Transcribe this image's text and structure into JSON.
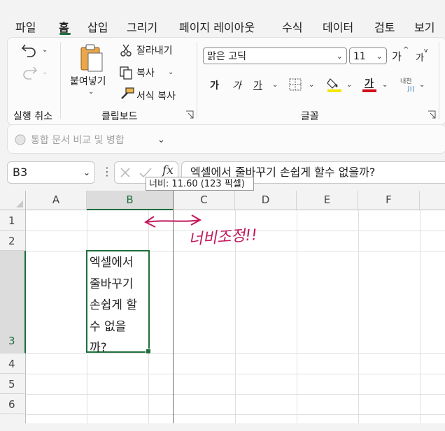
{
  "tabs": [
    "파일",
    "홈",
    "삽입",
    "그리기",
    "페이지 레이아웃",
    "수식",
    "데이터",
    "검토",
    "보기"
  ],
  "ribbon": {
    "paste_label": "붙여넣기",
    "cut_label": "잘라내기",
    "copy_label": "복사",
    "format_painter_label": "서식 복사",
    "undo_group_label": "실행 취소",
    "clipboard_group_label": "클립보드",
    "font_group_label": "글꼴",
    "font_name": "맑은 고딕",
    "font_size": "11",
    "grow_font_label": "가",
    "shrink_font_label": "가",
    "bold_label": "가",
    "italic_label": "가",
    "underline_label": "가",
    "font_color_label": "가",
    "phonetic_label": "내천",
    "highlight_color": "#f5e600",
    "font_color": "#d0101c"
  },
  "collab": {
    "compare_merge_label": "통합 문서 비교 및 병합"
  },
  "formula_bar": {
    "name_box": "B3",
    "fx_label": "fx",
    "content": "엑셀에서 줄바꾸기 손쉽게 할수 없을까?"
  },
  "tooltip": "너비: 11.60 (123 픽셀)",
  "columns": [
    "A",
    "B",
    "C",
    "D",
    "E",
    "F"
  ],
  "rows": [
    "1",
    "2",
    "3",
    "4",
    "5",
    "6"
  ],
  "cell_b3_lines": [
    "엑셀에서",
    "줄바꾸기",
    "손쉽게 할",
    "수 없을",
    "까?"
  ],
  "annotation": {
    "text": "너비조정!!",
    "color": "#c2185b"
  }
}
